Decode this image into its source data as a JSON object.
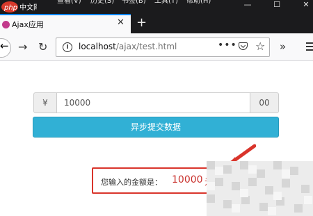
{
  "menubar": {
    "watermark_text": "php中文网",
    "items": [
      "查看(V)",
      "历史(S)",
      "书签(B)",
      "工具(T)",
      "帮助(H)"
    ],
    "minimize_glyph": "—",
    "maximize_glyph": "☐",
    "close_glyph": "✕"
  },
  "tab": {
    "title": "Ajax应用",
    "close_glyph": "✕",
    "new_tab_glyph": "+"
  },
  "navbar": {
    "back_glyph": "←",
    "forward_glyph": "→",
    "reload_glyph": "↻",
    "info_glyph": "i",
    "url_host": "localhost",
    "url_path": "/ajax/test.html",
    "page_actions_glyph": "•••",
    "bookmark_glyph": "☆",
    "overflow_glyph": "»"
  },
  "form": {
    "currency_addon": "¥",
    "amount_value": "10000",
    "cents_addon": "00",
    "submit_label": "异步提交数据"
  },
  "result": {
    "label": "您输入的金额是：",
    "value": "10000",
    "unit": "元"
  },
  "colors": {
    "accent_button": "#31b0d5",
    "result_border": "#d9342b",
    "result_text": "#c9302c"
  }
}
